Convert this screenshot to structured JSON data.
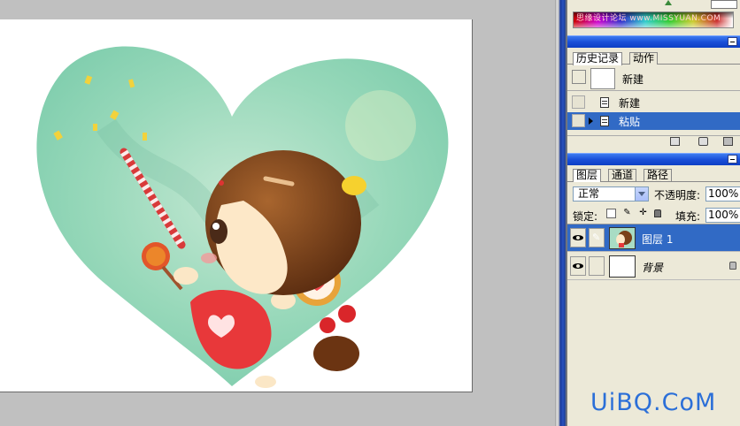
{
  "colors": {
    "selection": "#316ac5",
    "titlebar": "#1a4fd8",
    "panel_bg": "#ece9d8",
    "workspace_bg": "#c0c0c0",
    "watermark": "#2b6fd8"
  },
  "color_panel": {
    "watermark_text": "思缘设计论坛 www.MISSYUAN.COM"
  },
  "history_panel": {
    "tabs": [
      "历史记录",
      "动作"
    ],
    "snapshot_label": "新建",
    "states": [
      {
        "label": "新建",
        "selected": false
      },
      {
        "label": "粘贴",
        "selected": true
      }
    ],
    "footer_icons": [
      "new-document-icon",
      "camera-icon",
      "trash-icon"
    ]
  },
  "layers_panel": {
    "tabs": [
      "图层",
      "通道",
      "路径"
    ],
    "blend_mode": "正常",
    "opacity_label": "不透明度:",
    "opacity_value": "100%",
    "lock_label": "锁定:",
    "fill_label": "填充:",
    "fill_value": "100%",
    "layers": [
      {
        "name": "图层 1",
        "selected": true,
        "visible": true
      },
      {
        "name": "背景",
        "selected": false,
        "visible": true,
        "locked": true
      }
    ]
  },
  "site_watermark": "UiBQ.CoM"
}
